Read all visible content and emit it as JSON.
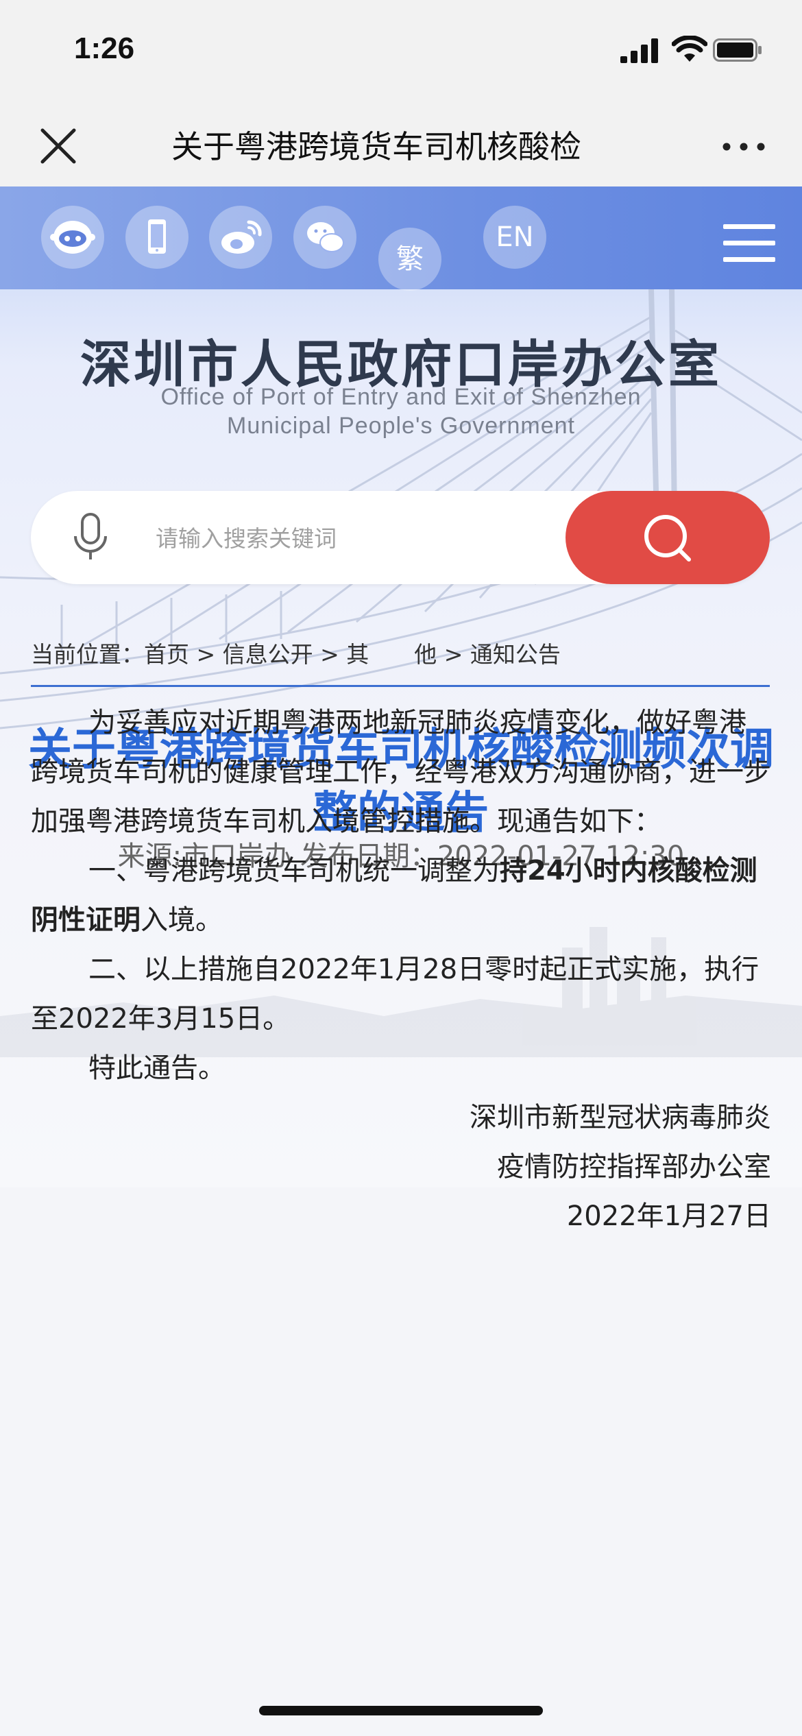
{
  "status": {
    "time": "1:26"
  },
  "nav": {
    "title": "关于粤港跨境货车司机核酸检"
  },
  "header": {
    "icons": [
      "robot-icon",
      "mobile-icon",
      "weibo-icon",
      "wechat-icon"
    ],
    "lang_traditional": "繁",
    "lang_english": "EN"
  },
  "logo": {
    "cn": "深圳市人民政府口岸办公室",
    "en_line1": "Office of Port of Entry and Exit of Shenzhen",
    "en_line2": "Municipal People's Government"
  },
  "search": {
    "placeholder": "请输入搜索关键词"
  },
  "breadcrumb": {
    "label": "当前位置：",
    "items": [
      "首页",
      "信息公开",
      "其　　他",
      "通知公告"
    ],
    "separator": " > "
  },
  "article": {
    "title": "关于粤港跨境货车司机核酸检测频次调整的通告",
    "meta": "来源:市口岸办 发布日期：2022-01-27 12:30",
    "p1": "为妥善应对近期粤港两地新冠肺炎疫情变化，做好粤港跨境货车司机的健康管理工作，经粤港双方沟通协商，进一步加强粤港跨境货车司机入境管控措施。现通告如下：",
    "p2_before": "一、粤港跨境货车司机统一调整为",
    "p2_bold": "持24小时内核酸检测阴性证明",
    "p2_after": "入境。",
    "p3": "二、以上措施自2022年1月28日零时起正式实施，执行至2022年3月15日。",
    "p4": "特此通告。",
    "sign1": "深圳市新型冠状病毒肺炎",
    "sign2": "疫情防控指挥部办公室",
    "sign_date": "2022年1月27日"
  },
  "colors": {
    "accent": "#2b68d6",
    "search_button": "#e14b45",
    "header_bar": "#6d8fe2"
  }
}
